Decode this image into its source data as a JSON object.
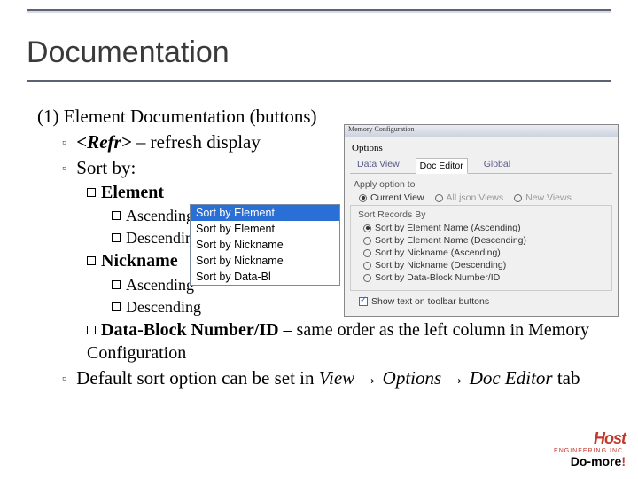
{
  "title": "Documentation",
  "section_heading": "(1) Element Documentation (buttons)",
  "bullets": {
    "refr_code": "<Refr>",
    "refr_text": " – refresh display",
    "sortby": "Sort by:",
    "element": "Element",
    "asc1": "Ascending",
    "desc1": "Descending",
    "nickname": "Nickname",
    "asc2": "Ascending",
    "desc2": "Descending",
    "datablock_bold": "Data-Block Number/ID",
    "datablock_rest": " – same order as the left column in Memory Configuration",
    "default_sort_pre": "Default sort option can be set in ",
    "view": "View",
    "arrow": " → ",
    "options": "Options",
    "doc_editor": "Doc Editor",
    "tab_word": " tab"
  },
  "dropdown": {
    "items": [
      "Sort by Element",
      "Sort by Element",
      "Sort by Nickname",
      "Sort by Nickname",
      "Sort by Data-Bl"
    ],
    "selected_index": 0
  },
  "dialog": {
    "winbar_title": "Memory Configuration",
    "title": "Options",
    "tabs": {
      "t0": "Data View",
      "t1": "Doc Editor",
      "t2": "Global"
    },
    "apply_label": "Apply option to",
    "apply": {
      "r0": "Current View",
      "r1": "All json Views",
      "r2": "New Views"
    },
    "sort_label": "Sort Records By",
    "sort": {
      "r0": "Sort by Element Name (Ascending)",
      "r1": "Sort by Element Name (Descending)",
      "r2": "Sort by Nickname (Ascending)",
      "r3": "Sort by Nickname (Descending)",
      "r4": "Sort by Data-Block Number/ID"
    },
    "show_text": "Show text on toolbar buttons"
  },
  "logo": {
    "host": "Host",
    "eng": "ENGINEERING INC.",
    "domore": "Do-more",
    "excl": "!"
  }
}
